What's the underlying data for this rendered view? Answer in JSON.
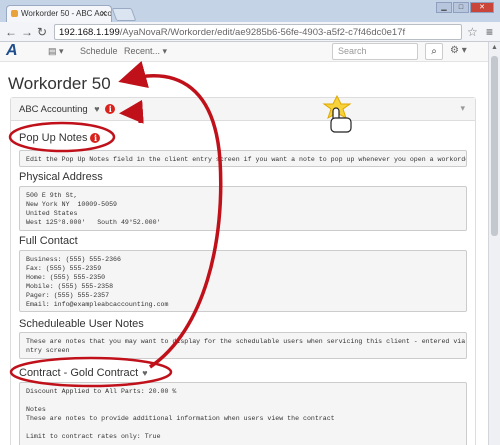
{
  "browser": {
    "tab_title": "Workorder 50 - ABC Acco",
    "url_host": "192.168.1.199",
    "url_path": "/AyaNovaR/Workorder/edit/ae9285b6-56fe-4903-a5f2-c7f46dc0e17f"
  },
  "nav": {
    "items": [
      "Schedule",
      "Recent..."
    ],
    "search_placeholder": "Search"
  },
  "page": {
    "title": "Workorder 50"
  },
  "client": {
    "name": "ABC Accounting"
  },
  "sections": {
    "popup_title": "Pop Up Notes",
    "popup_text": "Edit the Pop Up Notes field in the client entry screen if you want a note to pop up whenever you open a workorder.",
    "address_title": "Physical Address",
    "address_lines": "500 E 9th St,\nNew York NY  10009-5059\nUnited States\nWest 125°8.000'   South 49°52.000'",
    "contact_title": "Full Contact",
    "contact_lines": "Business: (555) 555-2366\nFax: (555) 555-2359\nHome: (555) 555-2350\nMobile: (555) 555-2358\nPager: (555) 555-2357\nEmail: info@exampleabcaccounting.com",
    "sched_title": "Scheduleable User Notes",
    "sched_text": "These are notes that you may want to display for the schedulable users when servicing this client - entered via the client e\nntry screen",
    "contract_title": "Contract - Gold Contract",
    "contract_lines": "Discount Applied to All Parts: 20.00 %\n\nNotes\nThese are notes to provide additional information when users view the contract\n\nLimit to contract rates only: True"
  },
  "colors": {
    "annotation": "#c0111b",
    "logo": "#1f4e8c"
  }
}
